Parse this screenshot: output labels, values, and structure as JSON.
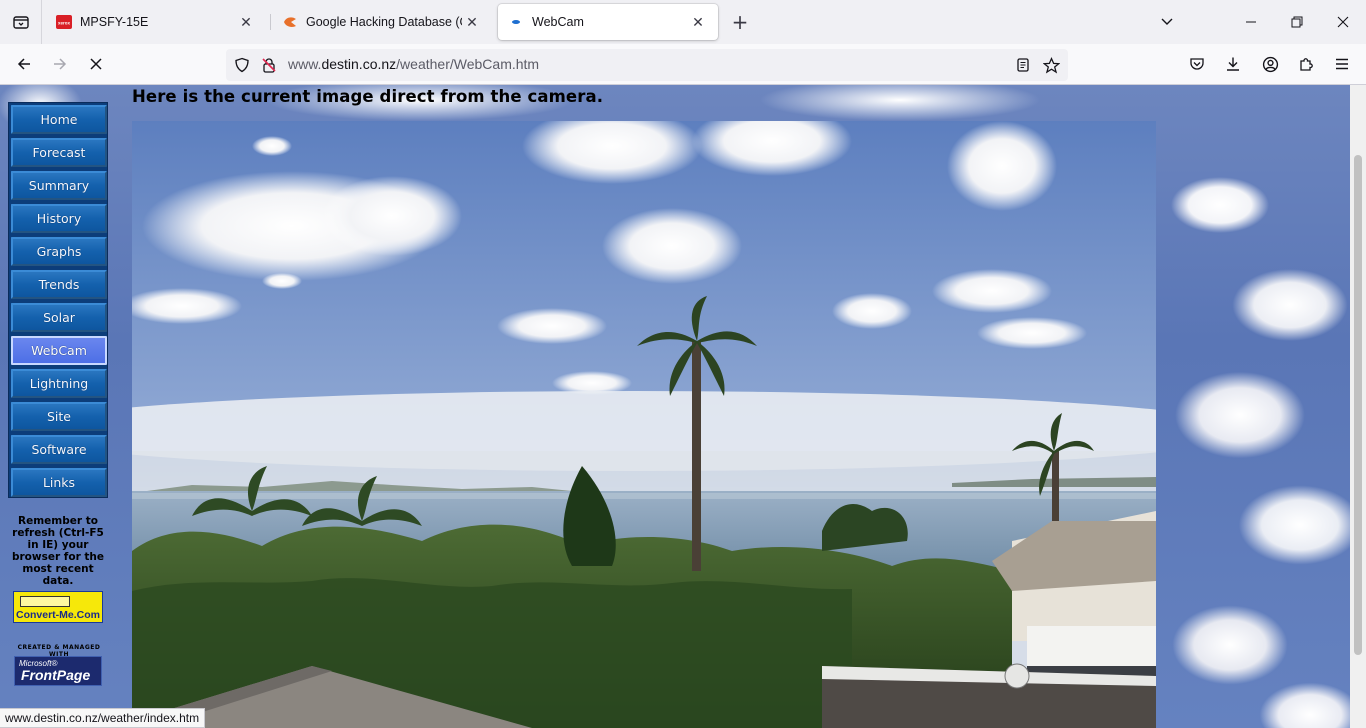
{
  "browser": {
    "tabs": [
      {
        "title": "MPSFY-15E",
        "favicon": "xerox-icon",
        "active": false
      },
      {
        "title": "Google Hacking Database (GHDB)",
        "favicon": "exploit-db-icon",
        "active": false
      },
      {
        "title": "WebCam",
        "favicon": "webcam-site-icon",
        "active": true
      }
    ],
    "address": {
      "prefix": "www.",
      "host": "destin.co.nz",
      "path": "/weather/WebCam.htm"
    },
    "status_url": "www.destin.co.nz/weather/index.htm"
  },
  "page": {
    "heading": "Here is the current image direct from the camera.",
    "nav": [
      {
        "label": "Home"
      },
      {
        "label": "Forecast"
      },
      {
        "label": "Summary"
      },
      {
        "label": "History"
      },
      {
        "label": "Graphs"
      },
      {
        "label": "Trends"
      },
      {
        "label": "Solar"
      },
      {
        "label": "WebCam",
        "current": true
      },
      {
        "label": "Lightning"
      },
      {
        "label": "Site"
      },
      {
        "label": "Software"
      },
      {
        "label": "Links"
      }
    ],
    "remember_note": "Remember to refresh (Ctrl-F5 in IE) your browser for the most recent data.",
    "convert_badge": "Convert-Me.Com",
    "frontpage_caption": "CREATED & MANAGED WITH",
    "frontpage_ms": "Microsoft®",
    "frontpage_name": "FrontPage"
  },
  "colors": {
    "nav_panel": "#0c3d7a",
    "nav_button": "#1461ad",
    "nav_current": "#4d6fe6",
    "badge_yellow": "#f6e80a"
  }
}
